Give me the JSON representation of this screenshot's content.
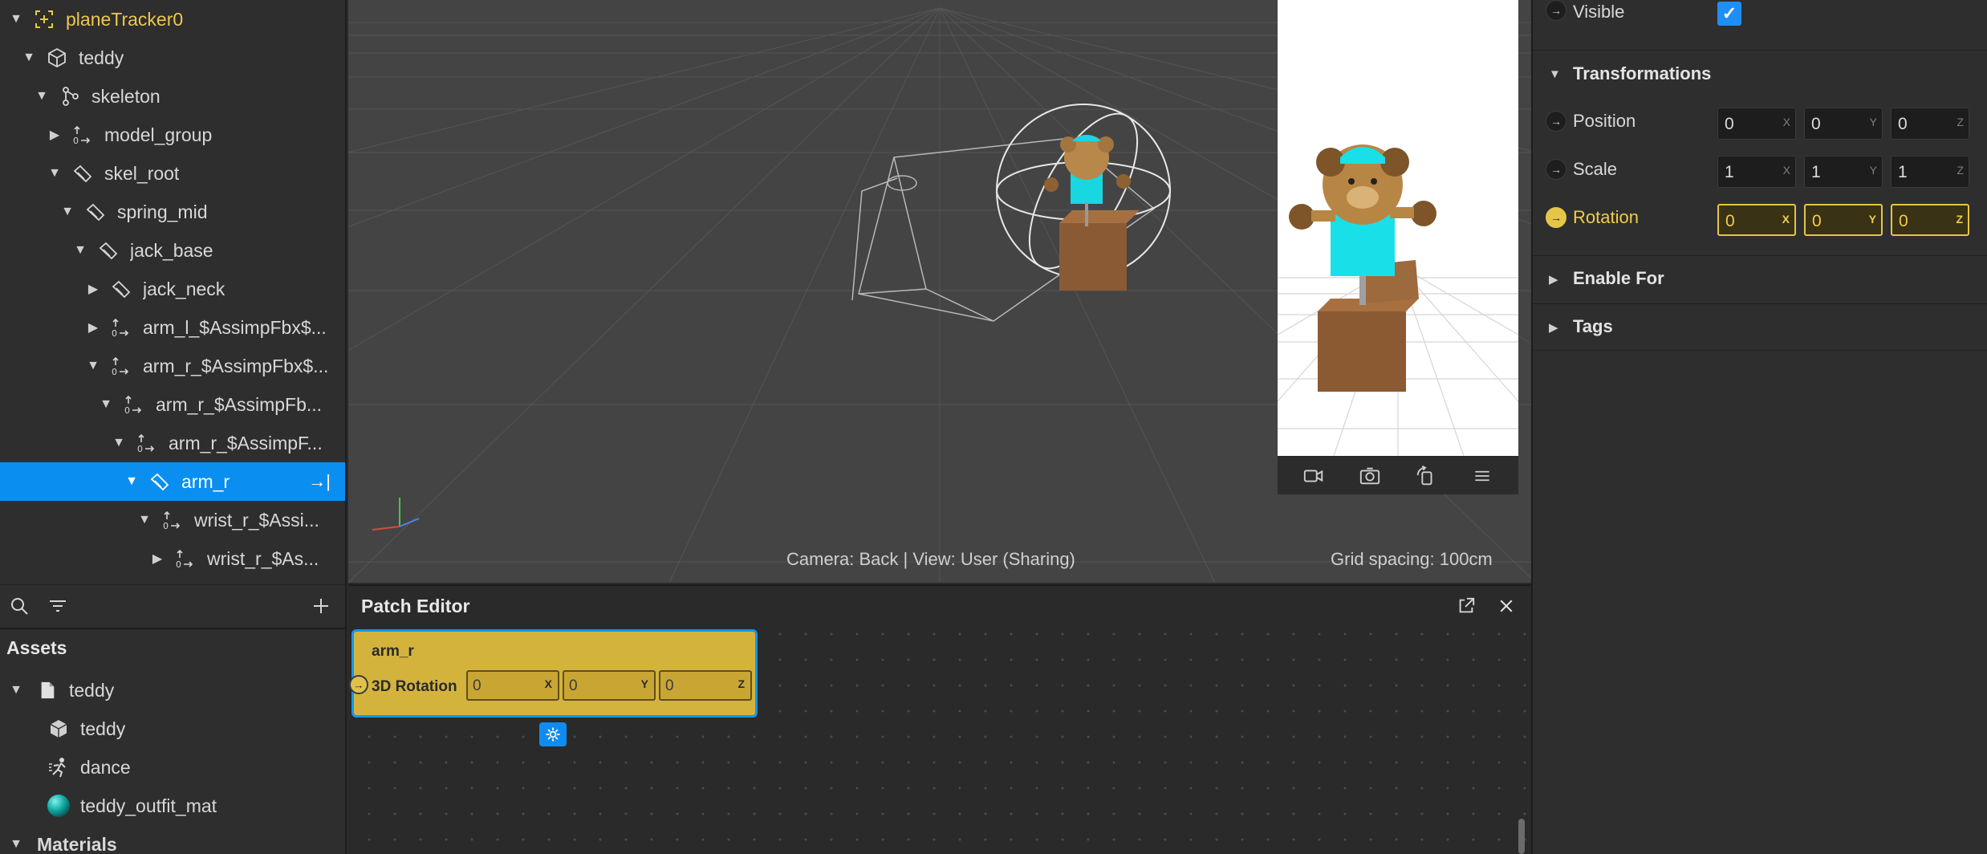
{
  "scene_tree": [
    {
      "label": "planeTracker0",
      "expanded": true,
      "icon": "plane-tracker-icon",
      "highlight": true
    },
    {
      "label": "teddy",
      "expanded": true,
      "icon": "cube-icon"
    },
    {
      "label": "skeleton",
      "expanded": true,
      "icon": "skeleton-icon"
    },
    {
      "label": "model_group",
      "expanded": false,
      "icon": "null-object-icon"
    },
    {
      "label": "skel_root",
      "expanded": true,
      "icon": "joint-icon"
    },
    {
      "label": "spring_mid",
      "expanded": true,
      "icon": "joint-icon"
    },
    {
      "label": "jack_base",
      "expanded": true,
      "icon": "joint-icon"
    },
    {
      "label": "jack_neck",
      "expanded": false,
      "icon": "joint-icon"
    },
    {
      "label": "arm_l_$AssimpFbx$...",
      "expanded": false,
      "icon": "null-object-icon"
    },
    {
      "label": "arm_r_$AssimpFbx$...",
      "expanded": true,
      "icon": "null-object-icon"
    },
    {
      "label": "arm_r_$AssimpFb...",
      "expanded": true,
      "icon": "null-object-icon"
    },
    {
      "label": "arm_r_$AssimpF...",
      "expanded": true,
      "icon": "null-object-icon"
    },
    {
      "label": "arm_r",
      "expanded": true,
      "icon": "joint-icon",
      "selected": true
    },
    {
      "label": "wrist_r_$Assi...",
      "expanded": true,
      "icon": "null-object-icon"
    },
    {
      "label": "wrist_r_$As...",
      "expanded": false,
      "icon": "null-object-icon"
    }
  ],
  "assets": {
    "header": "Assets",
    "items": [
      {
        "label": "teddy",
        "icon": "file-icon",
        "expandable": true
      },
      {
        "label": "teddy",
        "icon": "cube-icon"
      },
      {
        "label": "dance",
        "icon": "animation-icon"
      },
      {
        "label": "teddy_outfit_mat",
        "icon": "material-sphere-icon"
      }
    ],
    "materials_label": "Materials"
  },
  "viewport": {
    "camera_status": "Camera: Back | View: User (Sharing)",
    "grid_status": "Grid spacing: 100cm"
  },
  "patch_editor": {
    "title": "Patch Editor",
    "node": {
      "title": "arm_r",
      "port_label": "3D Rotation",
      "fields": [
        {
          "value": "0",
          "axis": "X"
        },
        {
          "value": "0",
          "axis": "Y"
        },
        {
          "value": "0",
          "axis": "Z"
        }
      ]
    }
  },
  "inspector": {
    "visible_label": "Visible",
    "visible_checked": true,
    "transformations_label": "Transformations",
    "position": {
      "label": "Position",
      "values": [
        {
          "value": "0",
          "axis": "X"
        },
        {
          "value": "0",
          "axis": "Y"
        },
        {
          "value": "0",
          "axis": "Z"
        }
      ]
    },
    "scale": {
      "label": "Scale",
      "values": [
        {
          "value": "1",
          "axis": "X"
        },
        {
          "value": "1",
          "axis": "Y"
        },
        {
          "value": "1",
          "axis": "Z"
        }
      ]
    },
    "rotation": {
      "label": "Rotation",
      "values": [
        {
          "value": "0",
          "axis": "X"
        },
        {
          "value": "0",
          "axis": "Y"
        },
        {
          "value": "0",
          "axis": "Z"
        }
      ]
    },
    "enable_for_label": "Enable For",
    "tags_label": "Tags"
  },
  "colors": {
    "accent": "#0a8ff0",
    "patch_gold": "#d4b33d",
    "highlight_yellow": "#f0cb4f"
  }
}
